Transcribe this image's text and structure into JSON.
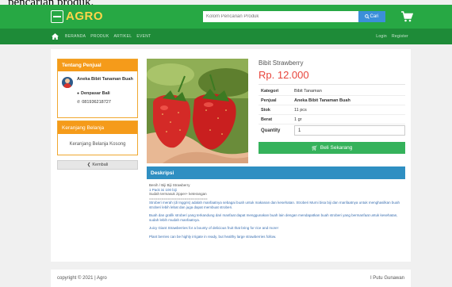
{
  "caption_text": "pencarian produk.",
  "header": {
    "logo_text": "AGRO",
    "search_placeholder": "Kolom Pencarian Produk",
    "search_button": "Cari"
  },
  "nav": {
    "links": [
      "BERANDA",
      "PRODUK",
      "ARTIKEL",
      "EVENT"
    ],
    "login": "Login",
    "register": "Register"
  },
  "seller": {
    "heading": "Tentang Penjual",
    "name": "Aneka Bibit Tanaman Buah",
    "location": "Denpasar Bali",
    "phone": "081936218727"
  },
  "cart": {
    "heading": "Keranjang Belanja",
    "empty_text": "Keranjang Belanja Kosong"
  },
  "back_button": "Kembali",
  "product": {
    "name": "Bibit Strawberry",
    "price": "Rp. 12.000",
    "details": [
      {
        "key": "Kategori",
        "value": "Bibit Tanaman",
        "bold": false
      },
      {
        "key": "Penjual",
        "value": "Aneka Bibit Tanaman Buah",
        "bold": true
      },
      {
        "key": "Stok",
        "value": "11 pcs",
        "bold": false
      },
      {
        "key": "Berat",
        "value": "1 gr",
        "bold": false
      }
    ],
    "quantity_label": "Quantity",
    "quantity_value": "1",
    "buy_button": "Beli Sekarang"
  },
  "description": {
    "heading": "Deskripsi",
    "lines_top": [
      "Benih / Biji Biji Strawberry",
      "1 Pack isi 100 biji",
      "Sudah termasuk zipper+ keterangan"
    ],
    "separator": "============================",
    "para1": "Stroberi merah (di Inggris) adalah manfaatnya sebagai buah untuk makanan dan kesehatan. Stroberi Murni bisa biji dan manfaatnya untuk menghasilkan buah stroberi lebih lebat dan juga dapat membuat stroberi.",
    "para2": "Buah dan grafik stroberi yang terkandung dari manfaat dapat menggunakan buah lain dengan mendapatkan buah stroberi yang bermanfaat untuk kesehatan, sudah lebih mudah manfaatnya.",
    "para3": "Juicy Giant Strawberries for a bounty of delicious fruit that bring for rice and more!",
    "para4": "Plant berries can be highly irrigate in ready, but healthy large strawberries follow."
  },
  "footer": {
    "copyright": "copyright © 2021 | Agro",
    "author": "I Putu Gunawan"
  },
  "colors": {
    "header_green": "#27a844",
    "nav_green": "#1e8b38",
    "logo_yellow": "#ffd54a",
    "panel_orange": "#f59b1a",
    "price_red": "#e8453c",
    "buy_green": "#35b25b",
    "desc_blue": "#2f8fc2",
    "search_blue": "#3b8fd9"
  }
}
